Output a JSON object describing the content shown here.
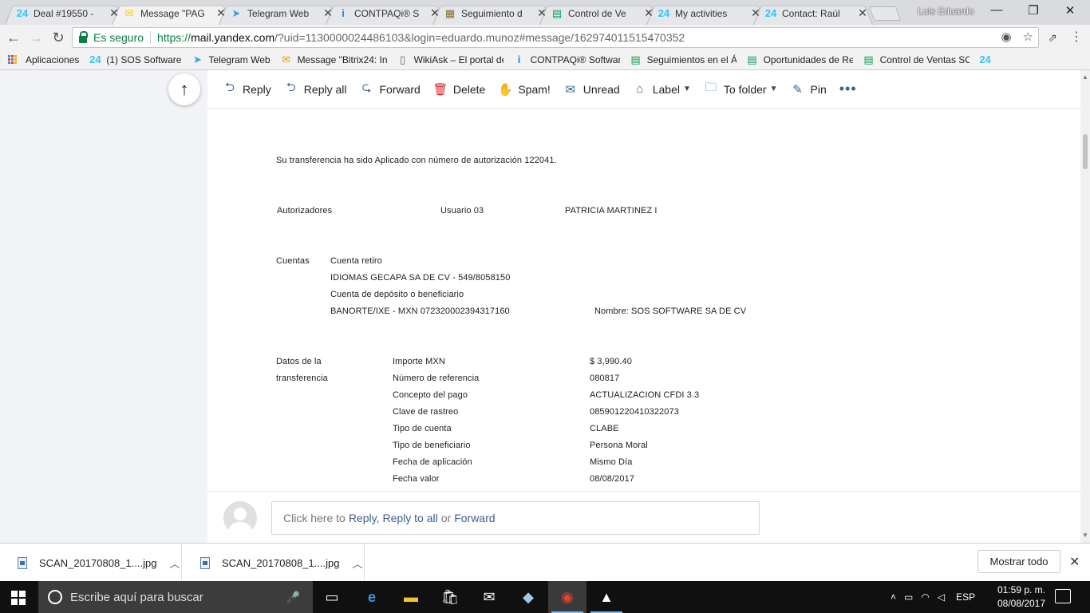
{
  "browser": {
    "tabs": [
      {
        "icon": "bitrix24-icon",
        "favicon": "24",
        "color": "#2fc6f6",
        "title": "Deal #19550 -",
        "active": false
      },
      {
        "icon": "yandex-mail-icon",
        "favicon": "✉",
        "color": "#ffcc00",
        "title": "Message \"PAG",
        "active": true
      },
      {
        "icon": "telegram-icon",
        "favicon": "➤",
        "color": "#2ca5e0",
        "title": "Telegram Web",
        "active": false
      },
      {
        "icon": "contpaqi-icon",
        "favicon": "i",
        "color": "#1e88e5",
        "title": "CONTPAQi® S",
        "active": false
      },
      {
        "icon": "chart-icon",
        "favicon": "▦",
        "color": "#8a6d3b",
        "title": "Seguimiento d",
        "active": false
      },
      {
        "icon": "sheets-icon",
        "favicon": "▤",
        "color": "#0f9d58",
        "title": "Control de Ve",
        "active": false
      },
      {
        "icon": "bitrix24-icon",
        "favicon": "24",
        "color": "#2fc6f6",
        "title": "My activities",
        "active": false
      },
      {
        "icon": "bitrix24-icon",
        "favicon": "24",
        "color": "#2fc6f6",
        "title": "Contact: Raúl",
        "active": false
      }
    ],
    "profile_name": "Luis Eduardo",
    "window_controls": {
      "minimize": "—",
      "restore": "❐",
      "close": "✕"
    },
    "nav": {
      "back": "←",
      "forward": "→",
      "reload": "↻"
    },
    "secure_label": "Es seguro",
    "url": {
      "scheme": "https://",
      "host": "mail.yandex.com",
      "rest": "/?uid=1130000024486103&login=eduardo.munoz#message/162974011515470352"
    },
    "bookmarks": [
      {
        "icon": "apps-icon",
        "label": "Aplicaciones"
      },
      {
        "icon": "bitrix24-icon",
        "favicon": "24",
        "color": "#2fc6f6",
        "label": "(1) SOS Software"
      },
      {
        "icon": "telegram-icon",
        "favicon": "➤",
        "color": "#2ca5e0",
        "label": "Telegram Web"
      },
      {
        "icon": "yandex-mail-icon",
        "favicon": "✉",
        "color": "#e8a400",
        "label": "Message \"Bitrix24: In"
      },
      {
        "icon": "page-icon",
        "favicon": "▯",
        "color": "#666666",
        "label": "WikiAsk – El portal de"
      },
      {
        "icon": "contpaqi-icon",
        "favicon": "i",
        "color": "#1e88e5",
        "label": "CONTPAQi® Softwar"
      },
      {
        "icon": "sheets-icon",
        "favicon": "▤",
        "color": "#0f9d58",
        "label": "Seguimientos en el Á"
      },
      {
        "icon": "sheets-icon",
        "favicon": "▤",
        "color": "#0f9d58",
        "label": "Oportunidades de Re"
      },
      {
        "icon": "sheets-icon",
        "favicon": "▤",
        "color": "#0f9d58",
        "label": "Control de Ventas SO"
      },
      {
        "icon": "bitrix24-icon",
        "favicon": "24",
        "color": "#2fc6f6",
        "label": ""
      }
    ]
  },
  "mail": {
    "toolbar": {
      "reply": "Reply",
      "reply_all": "Reply all",
      "forward": "Forward",
      "delete": "Delete",
      "spam": "Spam!",
      "unread": "Unread",
      "label": "Label",
      "to_folder": "To folder",
      "pin": "Pin"
    },
    "body": {
      "intro": "Su transferencia ha sido Aplicado con número de autorización 122041.",
      "autorizadores_label": "Autorizadores",
      "usuario": "Usuario 03",
      "autorizador_nombre": "PATRICIA MARTINEZ I",
      "cuentas_label": "Cuentas",
      "cuenta_retiro_label": "Cuenta retiro",
      "cuenta_retiro_value": "IDIOMAS GECAPA SA DE CV - 549/8058150",
      "cuenta_deposito_label": "Cuenta de depósito o beneficiario",
      "cuenta_deposito_value": "BANORTE/IXE - MXN 072320002394317160",
      "nombre_beneficiario": "Nombre: SOS SOFTWARE SA DE CV",
      "datos_label_1": "Datos de la",
      "datos_label_2": "transferencia",
      "fields": [
        {
          "label": "Importe MXN",
          "value": "$ 3,990.40"
        },
        {
          "label": "Número de referencia",
          "value": "080817"
        },
        {
          "label": "Concepto del pago",
          "value": "ACTUALIZACION CFDI 3.3"
        },
        {
          "label": "Clave de rastreo",
          "value": "085901220410322073"
        },
        {
          "label": "Tipo de cuenta",
          "value": "CLABE"
        },
        {
          "label": "Tipo de beneficiario",
          "value": "Persona Moral"
        },
        {
          "label": "Fecha de aplicación",
          "value": "Mismo Día"
        },
        {
          "label": "Fecha valor",
          "value": "08/08/2017"
        }
      ]
    },
    "quick_reply": {
      "prefix": "Click here to",
      "reply": "Reply,",
      "reply_all": "Reply to all",
      "or": "or",
      "forward": "Forward"
    }
  },
  "downloads": {
    "items": [
      {
        "name": "SCAN_20170808_1....jpg"
      },
      {
        "name": "SCAN_20170808_1....jpg"
      }
    ],
    "show_all": "Mostrar todo"
  },
  "taskbar": {
    "search_placeholder": "Escribe aquí para buscar",
    "language": "ESP",
    "time": "01:59 p. m.",
    "date": "08/08/2017"
  }
}
